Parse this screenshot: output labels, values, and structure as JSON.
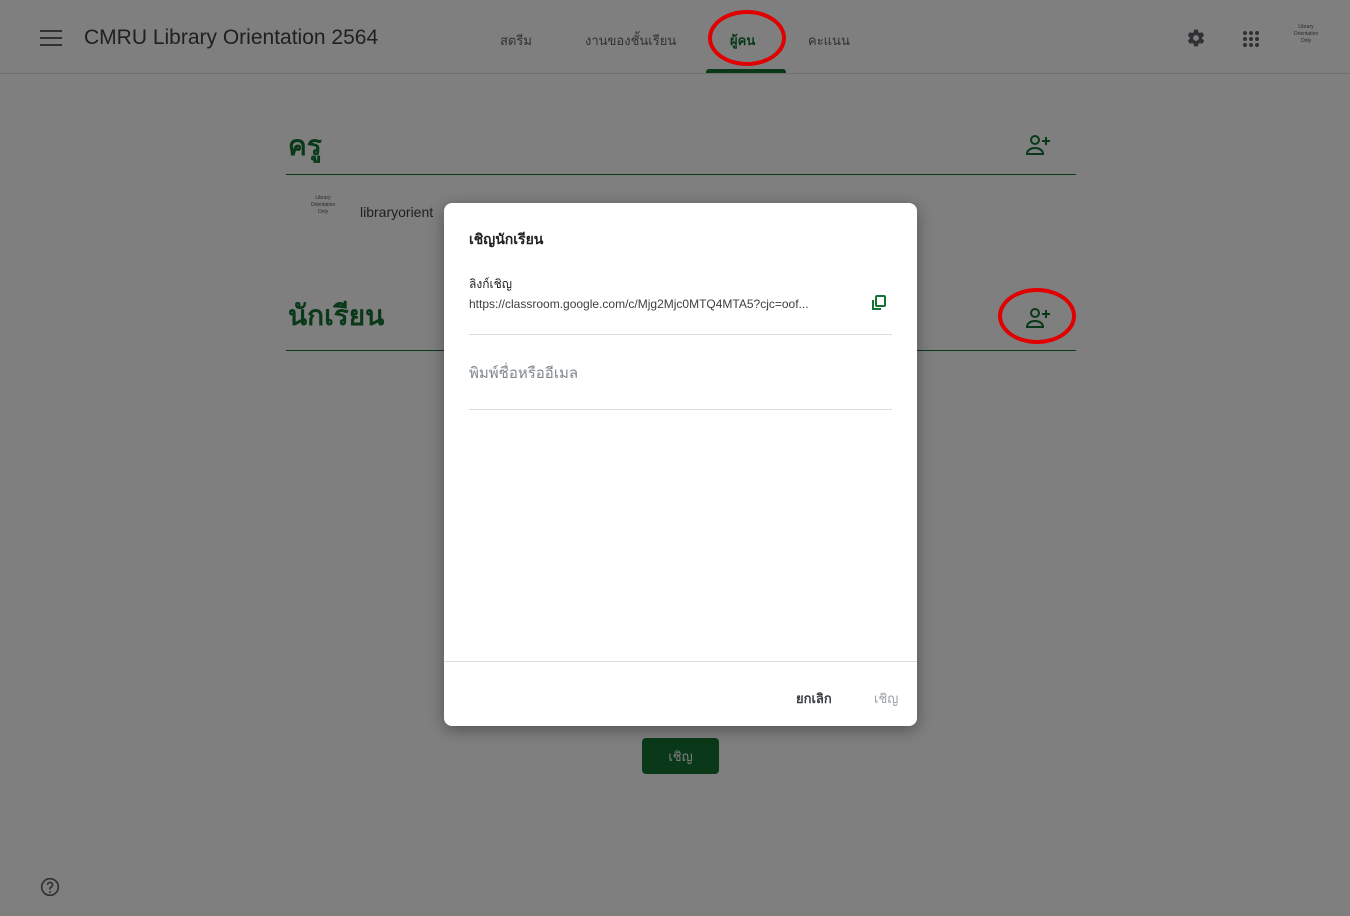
{
  "header": {
    "title": "CMRU Library Orientation 2564",
    "tabs": [
      {
        "label": "สตรีม"
      },
      {
        "label": "งานของชั้นเรียน"
      },
      {
        "label": "ผู้คน"
      },
      {
        "label": "คะแนน"
      }
    ],
    "active_tab": "ผู้คน",
    "account_logo": [
      "Library",
      "Orientation",
      "Only"
    ]
  },
  "teachers": {
    "title": "ครู",
    "items": [
      {
        "name": "libraryorient",
        "logo": [
          "Library",
          "Orientation",
          "Only"
        ]
      }
    ]
  },
  "students": {
    "title": "นักเรียน"
  },
  "page_invite_button": "เชิญ",
  "dialog": {
    "title": "เชิญนักเรียน",
    "link_label": "ลิงก์เชิญ",
    "link_url": "https://classroom.google.com/c/Mjg2Mjc0MTQ4MTA5?cjc=oof...",
    "input_placeholder": "พิมพ์ชื่อหรืออีเมล",
    "cancel_label": "ยกเลิก",
    "invite_label": "เชิญ"
  },
  "colors": {
    "accent": "#137333",
    "highlight_ring": "#e00000"
  }
}
